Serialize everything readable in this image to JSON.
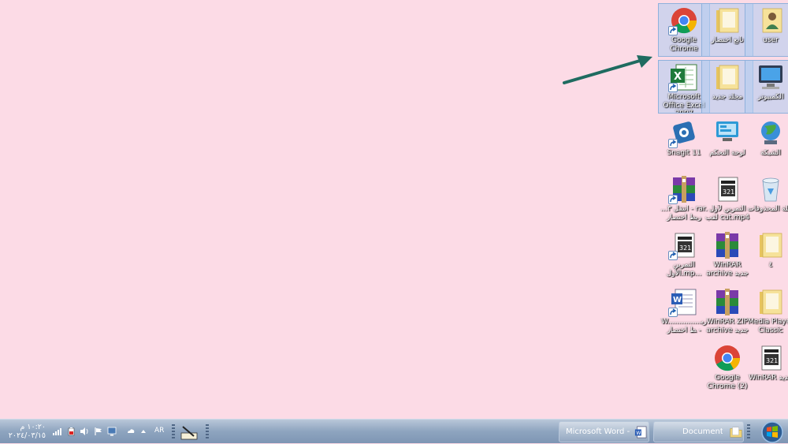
{
  "desktop": {
    "background_color": "#fcdbe6",
    "icons": [
      {
        "label": "Google Chrome",
        "icon": "chrome-icon",
        "shortcut": true,
        "selected": true
      },
      {
        "label": "تابع اختصار",
        "icon": "folder-icon",
        "shortcut": false,
        "selected": true
      },
      {
        "label": "user",
        "icon": "user-folder-icon",
        "shortcut": false,
        "selected": true
      },
      {
        "label": "Microsoft Office Excel 2007",
        "icon": "excel-icon",
        "shortcut": true,
        "selected": true
      },
      {
        "label": "مجلد جديد",
        "icon": "folder-icon",
        "shortcut": false,
        "selected": true
      },
      {
        "label": "الكمبيوتر",
        "icon": "computer-icon",
        "shortcut": false,
        "selected": true
      },
      {
        "label": "Snagit 11",
        "icon": "snagit-icon",
        "shortcut": true,
        "selected": false
      },
      {
        "label": "لوحة التحكم",
        "icon": "control-panel-icon",
        "shortcut": false,
        "selected": false
      },
      {
        "label": "الشبكة",
        "icon": "network-icon",
        "shortcut": false,
        "selected": false
      },
      {
        "label": "...انتقل ٣ - rar. ربط اختصار",
        "icon": "winrar-icon",
        "shortcut": true,
        "selected": false
      },
      {
        "label": "التمرين لأول لقب cut.mp4",
        "icon": "video-file-icon",
        "shortcut": false,
        "selected": false
      },
      {
        "label": "سلة المحذوفات",
        "icon": "recycle-bin-icon",
        "shortcut": false,
        "selected": false
      },
      {
        "label": "التمرين الأول.mp...",
        "icon": "video-file-icon",
        "shortcut": true,
        "selected": false
      },
      {
        "label": "WinRAR archive جديد",
        "icon": "winrar-icon",
        "shortcut": false,
        "selected": false
      },
      {
        "label": "٤",
        "icon": "folder-icon",
        "shortcut": false,
        "selected": false
      },
      {
        "label": "W...............ربط اختصار -",
        "icon": "word-doc-icon",
        "shortcut": true,
        "selected": false
      },
      {
        "label": "WinRAR ZIP archive جديد",
        "icon": "winrar-icon",
        "shortcut": false,
        "selected": false
      },
      {
        "label": "Media Player Classic",
        "icon": "folder-icon",
        "shortcut": false,
        "selected": false
      },
      {
        "label": "Google Chrome (2)",
        "icon": "chrome-icon",
        "shortcut": false,
        "selected": false
      },
      {
        "label": "WinRAR جديد",
        "icon": "video-file-icon",
        "shortcut": false,
        "selected": false
      }
    ]
  },
  "taskbar": {
    "clock_time": "١٠:٢٠ م",
    "clock_date": "٢٠٢٤/٠٣/١٥",
    "language": "AR",
    "tray_icons": [
      "signal-icon",
      "battery-icon",
      "speaker-icon",
      "flag-icon",
      "network-tray-icon",
      "onedrive-icon",
      "show-hidden-icon"
    ],
    "buttons": [
      {
        "label": "Microsoft Word - ...",
        "icon": "word-icon"
      },
      {
        "label": "Documents",
        "icon": "folder-icon"
      }
    ],
    "start": {
      "icon": "windows-orb-icon"
    }
  }
}
